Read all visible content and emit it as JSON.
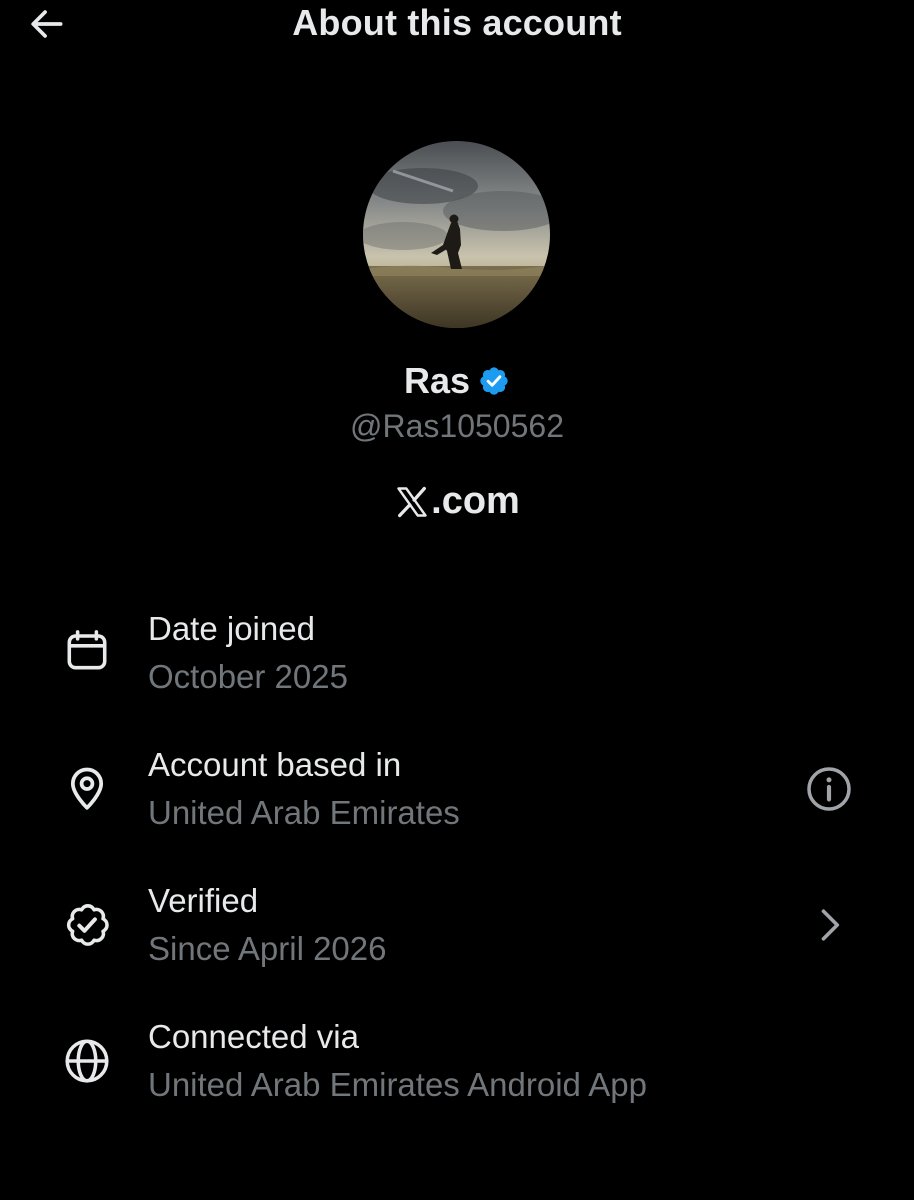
{
  "header": {
    "title": "About this account",
    "back_icon": "arrow-left-icon"
  },
  "profile": {
    "display_name": "Ras",
    "handle": "@Ras1050562",
    "verified": true,
    "badge_color": "#1d9bf0",
    "domain_suffix": ".com",
    "domain_logo": "x-logo-icon"
  },
  "rows": [
    {
      "icon": "calendar-icon",
      "label": "Date joined",
      "value": "October 2025"
    },
    {
      "icon": "location-pin-icon",
      "label": "Account based in",
      "value": "United Arab Emirates",
      "action_icon": "info-icon"
    },
    {
      "icon": "verified-check-icon",
      "label": "Verified",
      "value": "Since April 2026",
      "action_icon": "chevron-right-icon"
    },
    {
      "icon": "globe-icon",
      "label": "Connected via",
      "value": "United Arab Emirates Android App"
    }
  ],
  "colors": {
    "background": "#000000",
    "primary_text": "#e7e9ea",
    "secondary_text": "#71767b",
    "accent": "#1d9bf0"
  }
}
